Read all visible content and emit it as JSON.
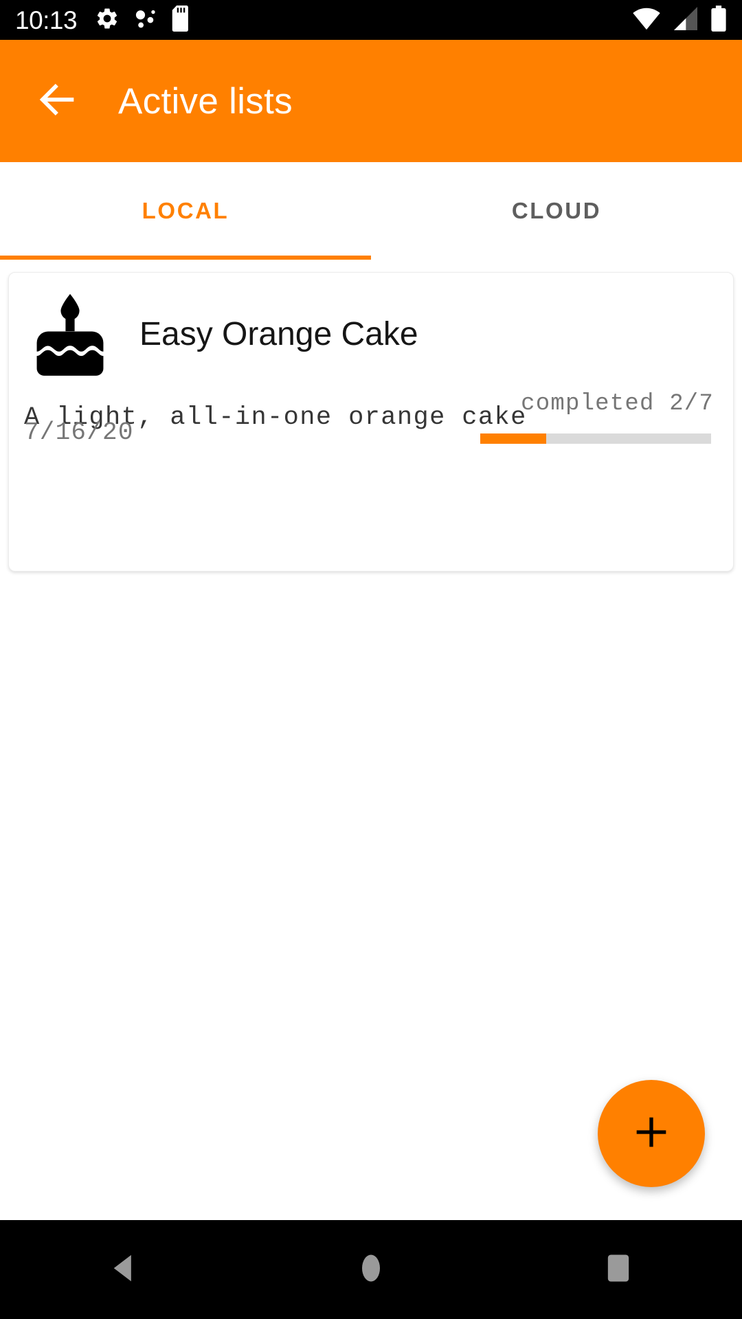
{
  "status_bar": {
    "clock": "10:13",
    "left_icons": [
      "gear-icon",
      "bluetooth-dots-icon",
      "sd-card-icon"
    ],
    "right_icons": [
      "wifi-icon",
      "cell-signal-icon",
      "battery-icon"
    ]
  },
  "app_bar": {
    "back_icon": "back-arrow-icon",
    "title": "Active lists",
    "background_color": "#FF8000",
    "text_color": "#FFFFFF"
  },
  "tabs": {
    "items": [
      {
        "label": "LOCAL",
        "active": true
      },
      {
        "label": "CLOUD",
        "active": false
      }
    ],
    "active_color": "#FF8000",
    "inactive_color": "#5E5E5E",
    "indicator_color": "#FF8000"
  },
  "list_card": {
    "icon": "birthday-cake-icon",
    "title": "Easy Orange Cake",
    "description": "A light, all-in-one orange cake",
    "date": "7/16/20",
    "progress_label": "completed 2/7",
    "progress_completed": 2,
    "progress_total": 7,
    "progress_percent": 28.6,
    "progress_fill_color": "#FF8000",
    "progress_track_color": "#DADADA"
  },
  "fab": {
    "icon": "plus-icon",
    "color": "#FF8000",
    "icon_color": "#000000"
  },
  "nav_bar": {
    "buttons": [
      {
        "name": "back-triangle-icon"
      },
      {
        "name": "home-circle-icon"
      },
      {
        "name": "recents-square-icon"
      }
    ],
    "icon_color": "#9A9A9A",
    "background_color": "#000000"
  }
}
